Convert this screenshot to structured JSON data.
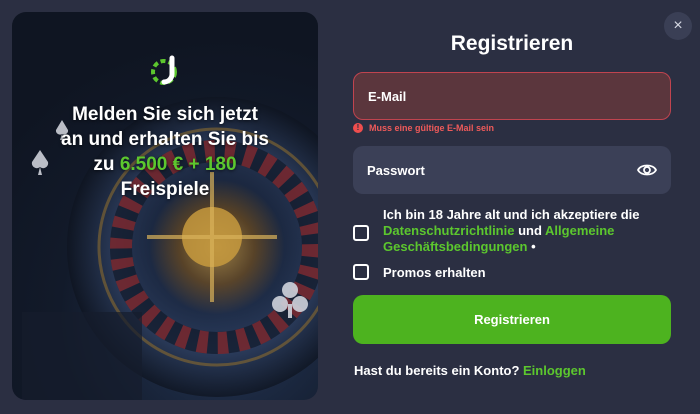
{
  "promo": {
    "line1": "Melden Sie sich jetzt",
    "line2": "an und erhalten Sie bis",
    "line3_prefix": "zu ",
    "line3_accent": "6.500 € + 180",
    "line4": "Freispiele",
    "logo_icon": "brand-logo-icon"
  },
  "form": {
    "title": "Registrieren",
    "close_label": "×",
    "email_placeholder": "E-Mail",
    "email_error": "Muss eine gültige E-Mail sein",
    "error_icon_glyph": "!",
    "password_placeholder": "Passwort",
    "terms_prefix": "Ich bin 18 Jahre alt und ich akzeptiere die ",
    "terms_link_privacy": "Datenschutzrichtlinie",
    "terms_and": " und ",
    "terms_link_tos": "Allgemeine Geschäftsbedingungen",
    "terms_required": " •",
    "promos_label": "Promos erhalten",
    "submit_label": "Registrieren",
    "have_account": "Hast du bereits ein Konto? ",
    "login_link": "Einloggen"
  },
  "colors": {
    "background": "#2b2f42",
    "accent": "#5cc72e",
    "button": "#4db31f",
    "error": "#ef5a5a",
    "field": "#3b4057"
  }
}
